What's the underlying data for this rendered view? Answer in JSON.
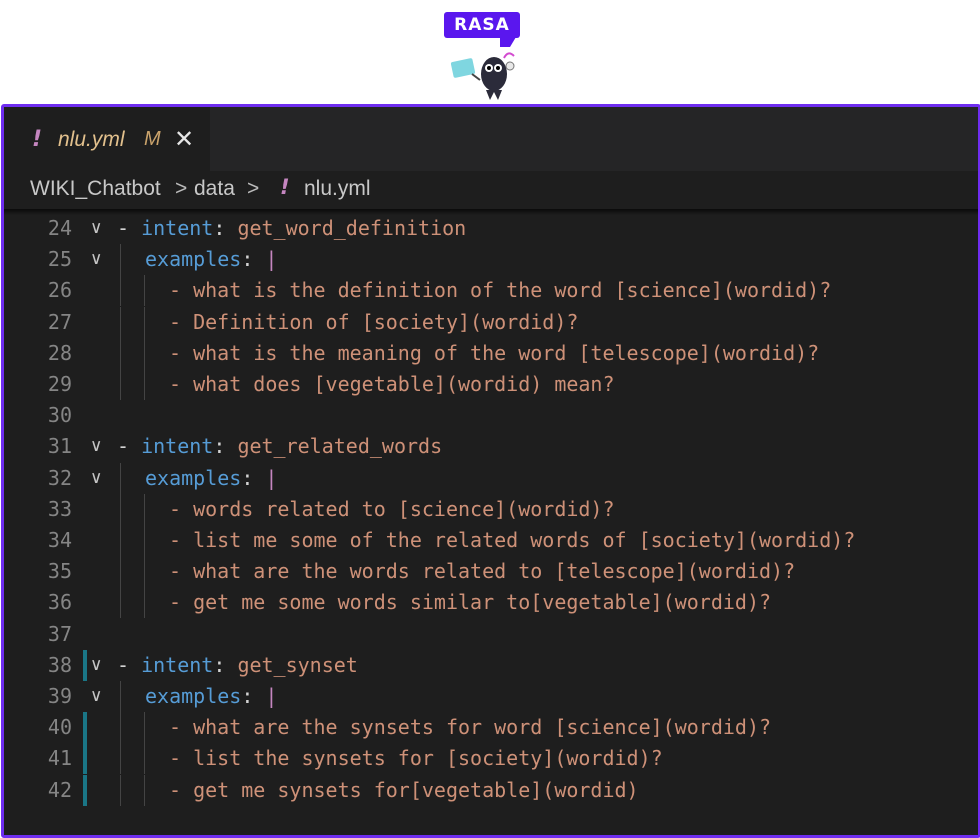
{
  "logo": {
    "text": "RASA"
  },
  "editor": {
    "tab": {
      "excl": "!",
      "filename": "nlu.yml",
      "modified": "M",
      "close": "✕"
    },
    "breadcrumbs": [
      "WIKI_Chatbot",
      "data",
      "nlu.yml"
    ],
    "breadcrumb_sep": ">",
    "breadcrumb_excl": "!",
    "lines": [
      {
        "n": "24",
        "kind": "intent",
        "name": "get_word_definition"
      },
      {
        "n": "25",
        "kind": "examples"
      },
      {
        "n": "26",
        "kind": "example",
        "text": "- what is the definition of the word [science](wordid)?"
      },
      {
        "n": "27",
        "kind": "example",
        "text": "- Definition of [society](wordid)?"
      },
      {
        "n": "28",
        "kind": "example",
        "text": "- what is the meaning of the word [telescope](wordid)?"
      },
      {
        "n": "29",
        "kind": "example",
        "text": "- what does [vegetable](wordid) mean?"
      },
      {
        "n": "30",
        "kind": "blank"
      },
      {
        "n": "31",
        "kind": "intent",
        "name": "get_related_words"
      },
      {
        "n": "32",
        "kind": "examples"
      },
      {
        "n": "33",
        "kind": "example",
        "text": "- words related to [science](wordid)?"
      },
      {
        "n": "34",
        "kind": "example",
        "text": "- list me some of the related words of [society](wordid)?"
      },
      {
        "n": "35",
        "kind": "example",
        "text": "- what are the words related to [telescope](wordid)?"
      },
      {
        "n": "36",
        "kind": "example",
        "text": "- get me some words similar to[vegetable](wordid)?"
      },
      {
        "n": "37",
        "kind": "blank"
      },
      {
        "n": "38",
        "kind": "intent",
        "name": "get_synset",
        "mark": true
      },
      {
        "n": "39",
        "kind": "examples"
      },
      {
        "n": "40",
        "kind": "example",
        "text": "- what are the synsets for word [science](wordid)?",
        "mark": true
      },
      {
        "n": "41",
        "kind": "example",
        "text": "- list the synsets for [society](wordid)?",
        "mark": true
      },
      {
        "n": "42",
        "kind": "example",
        "text": "- get me synsets for[vegetable](wordid)",
        "mark": true
      }
    ],
    "tokens": {
      "dash": "-",
      "intent_key": "intent",
      "examples_key": "examples",
      "colon": ":",
      "pipe": "|"
    }
  }
}
